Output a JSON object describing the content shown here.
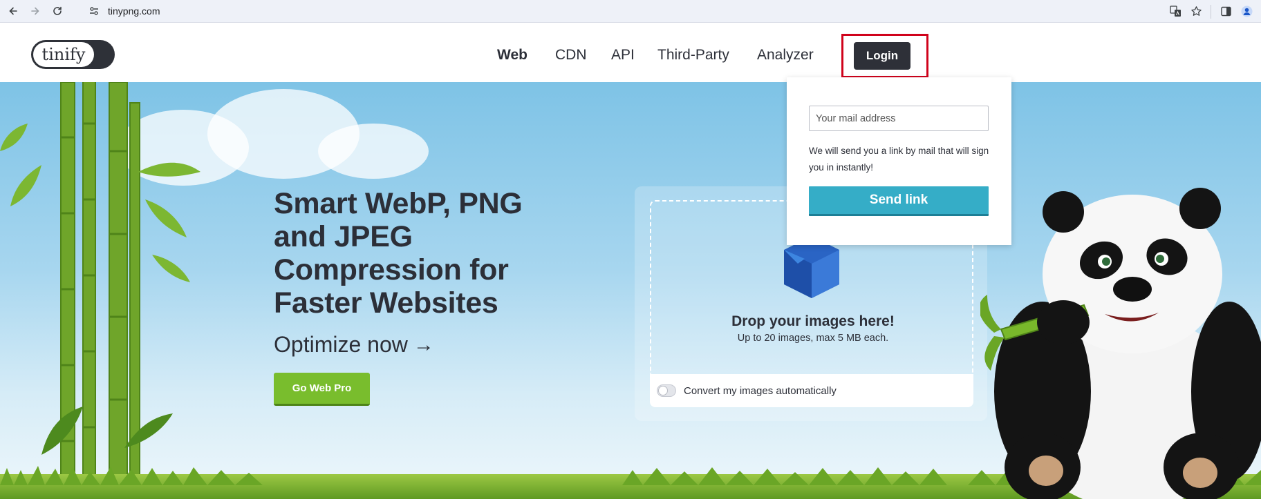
{
  "browser": {
    "url": "tinypng.com",
    "icons": {
      "back": "back-arrow-icon",
      "forward": "forward-arrow-icon",
      "reload": "reload-icon",
      "site_info": "tune-icon",
      "translate": "translate-icon",
      "bookmark": "star-icon",
      "side_panel": "side-panel-icon",
      "profile": "profile-icon"
    }
  },
  "header": {
    "logo_text": "tinify",
    "nav": {
      "web": "Web",
      "cdn": "CDN",
      "api": "API",
      "third_party": "Third-Party",
      "analyzer": "Analyzer"
    },
    "login_label": "Login"
  },
  "hero": {
    "title_lines": [
      "Smart WebP, PNG",
      "and JPEG",
      "Compression for",
      "Faster Websites"
    ],
    "optimize_label": "Optimize now",
    "optimize_arrow": "→",
    "pro_button": "Go Web Pro"
  },
  "dropzone": {
    "title": "Drop your images here!",
    "subtitle": "Up to 20 images, max 5 MB each.",
    "convert_label": "Convert my images automatically",
    "convert_enabled": false
  },
  "login_popup": {
    "email_placeholder": "Your mail address",
    "email_value": "",
    "info_text": "We will send you a link by mail that will sign you in instantly!",
    "send_button": "Send link"
  },
  "colors": {
    "dark": "#2e3038",
    "green": "#79bd2d",
    "teal": "#35adc7",
    "highlight": "#d0021b",
    "sky": "#7ec3e6"
  }
}
